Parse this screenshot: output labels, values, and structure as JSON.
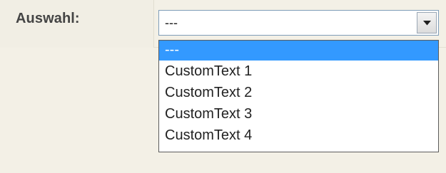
{
  "form": {
    "label": "Auswahl:",
    "select": {
      "value": "---",
      "options": [
        "---",
        "CustomText 1",
        "CustomText 2",
        "CustomText 3",
        "CustomText 4"
      ],
      "selected_index": 0,
      "highlight_color": "#3399ff"
    },
    "icons": {
      "dropdown": "chevron-down-icon"
    }
  }
}
